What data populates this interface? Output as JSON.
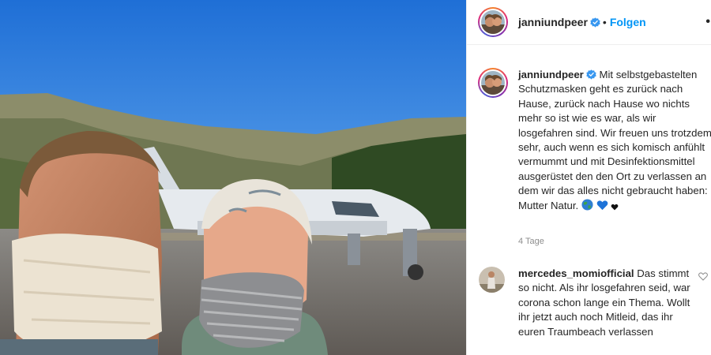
{
  "post": {
    "username": "janniundpeer",
    "separator": "•",
    "follow_label": "Folgen",
    "more_label": "•",
    "caption": "Mit selbstgebastelten Schutzmasken geht es zurück nach Hause, zurück nach Hause wo nichts mehr so ist wie es war, als wir losgefahren sind. Wir freuen uns trotzdem sehr, auch wenn es sich komisch anfühlt vermummt und mit Desinfektionsmittel ausgerüstet den den Ort zu verlassen an dem wir das alles nicht gebraucht haben: Mutter Natur.",
    "caption_emojis": [
      "globe-emoji",
      "blue-heart-emoji",
      "black-heart-emoji"
    ],
    "timestamp": "4 Tage"
  },
  "comment": {
    "username": "mercedes_momiofficial",
    "text": "Das stimmt so nicht. Als ihr losgefahren seid, war corona schon lange ein Thema. Wollt ihr jetzt auch noch Mitleid, das ihr euren Traumbeach verlassen"
  },
  "colors": {
    "accent": "#0095f6",
    "text": "#262626",
    "muted": "#8e8e8e",
    "verified": "#3897f0"
  },
  "icons": [
    "verified-badge-icon",
    "more-options-icon",
    "like-heart-icon"
  ]
}
